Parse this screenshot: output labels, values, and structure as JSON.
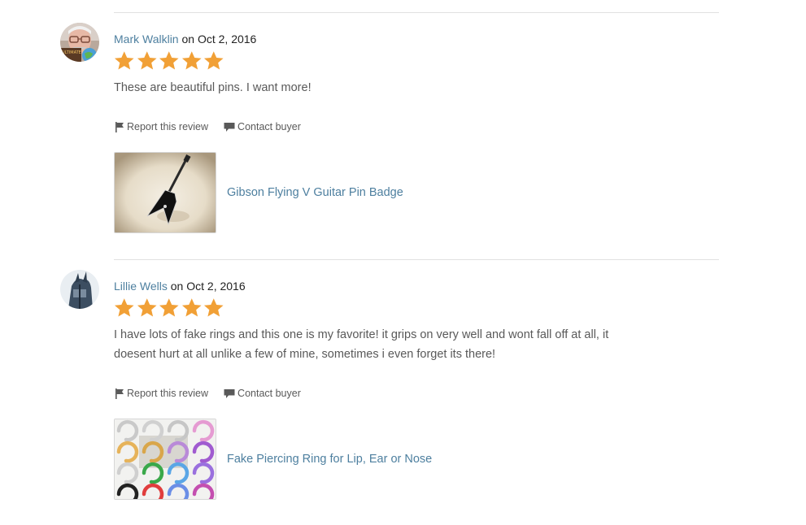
{
  "colors": {
    "link": "#4d7f9f",
    "text": "#595959",
    "star": "#f1a036",
    "divider": "#e1e1e1"
  },
  "reviews": [
    {
      "reviewer": "Mark Walklin",
      "date_prefix": "on",
      "date": "Oct 2, 2016",
      "avatar_text": "ULTIMATE\nTER",
      "rating": 5,
      "text": "These are beautiful pins. I want more!",
      "report_label": "Report this review",
      "contact_label": "Contact buyer",
      "product_title": "Gibson Flying V Guitar Pin Badge",
      "product_image": "guitar-pin-image"
    },
    {
      "reviewer": "Lillie Wells",
      "date_prefix": "on",
      "date": "Oct 2, 2016",
      "rating": 5,
      "text": "I have lots of fake rings and this one is my favorite! it grips on very well and wont fall off at all, it doesent hurt at all unlike a few of mine, sometimes i even forget its there!",
      "report_label": "Report this review",
      "contact_label": "Contact buyer",
      "product_title": "Fake Piercing Ring for Lip, Ear or Nose",
      "product_image": "piercing-rings-image"
    }
  ]
}
